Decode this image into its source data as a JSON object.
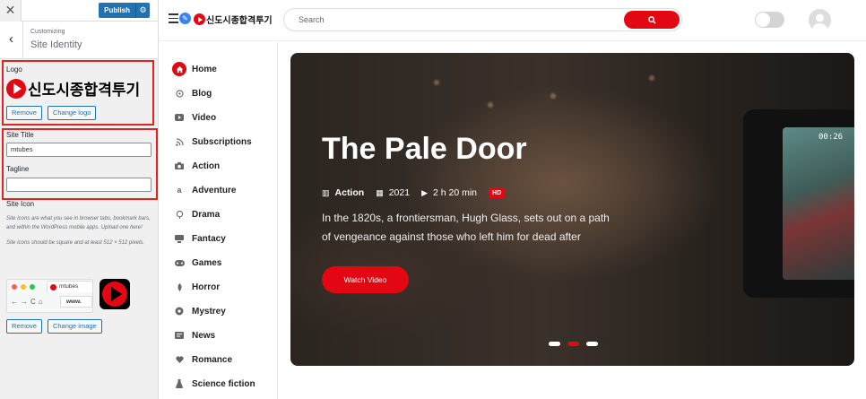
{
  "customizer": {
    "publish_label": "Publish",
    "crumb": "Customizing",
    "section_title": "Site Identity",
    "logo_label": "Logo",
    "logo_text": "신도시종합격투기",
    "remove_label": "Remove",
    "change_logo_label": "Change logo",
    "site_title_label": "Site Title",
    "site_title_value": "mtubes",
    "tagline_label": "Tagline",
    "tagline_value": "",
    "site_icon_label": "Site Icon",
    "site_icon_desc1": "Site Icons are what you see in browser tabs, bookmark bars, and within the WordPress mobile apps. Upload one here!",
    "site_icon_desc2": "Site Icons should be square and at least 512 × 512 pixels.",
    "preview_tab": "mtubes",
    "preview_url": "www.",
    "remove_icon_label": "Remove",
    "change_image_label": "Change image",
    "highlight_color": "#e02424"
  },
  "site": {
    "logo_text": "신도시종합격투기",
    "search_placeholder": "Search",
    "brand_color": "#e30613",
    "nav": [
      {
        "label": "Home",
        "icon": "home-icon"
      },
      {
        "label": "Blog",
        "icon": "blog-icon"
      },
      {
        "label": "Video",
        "icon": "video-icon"
      },
      {
        "label": "Subscriptions",
        "icon": "subscriptions-icon"
      },
      {
        "label": "Action",
        "icon": "camera-icon"
      },
      {
        "label": "Adventure",
        "icon": "adventure-icon"
      },
      {
        "label": "Drama",
        "icon": "drama-icon"
      },
      {
        "label": "Fantacy",
        "icon": "fantasy-icon"
      },
      {
        "label": "Games",
        "icon": "gamepad-icon"
      },
      {
        "label": "Horror",
        "icon": "horror-icon"
      },
      {
        "label": "Mystrey",
        "icon": "mystery-icon"
      },
      {
        "label": "News",
        "icon": "news-icon"
      },
      {
        "label": "Romance",
        "icon": "heart-icon"
      },
      {
        "label": "Science fiction",
        "icon": "flask-icon"
      }
    ],
    "hero": {
      "title": "The Pale Door",
      "genre": "Action",
      "year": "2021",
      "duration": "2 h 20 min",
      "quality": "HD",
      "description": "In the 1820s, a frontiersman, Hugh Glass, sets out on a path of vengeance against those who left him for dead after",
      "button_label": "Watch Video",
      "camera_time": "00:26",
      "slides": 3,
      "active_slide": 2
    }
  }
}
